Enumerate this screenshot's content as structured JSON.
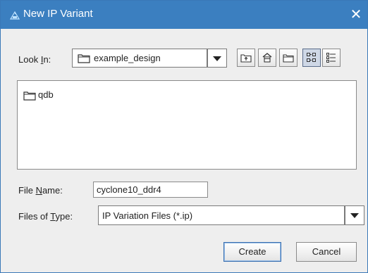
{
  "window": {
    "title": "New IP Variant",
    "close_glyph": "✕",
    "icon": "intel-fpga-icon",
    "titlebar_color": "#3b7fc0"
  },
  "look_in": {
    "label_prefix": "Look ",
    "label_mnemonic": "I",
    "label_suffix": "n:",
    "value": "example_design",
    "icon": "folder-icon"
  },
  "toolbar": {
    "buttons": [
      {
        "name": "up-one-level-button",
        "icon": "folder-up-icon"
      },
      {
        "name": "home-button",
        "icon": "home-icon"
      },
      {
        "name": "create-new-folder-button",
        "icon": "new-folder-icon"
      },
      {
        "name": "list-view-button",
        "icon": "list-view-icon",
        "active": true
      },
      {
        "name": "details-view-button",
        "icon": "details-view-icon"
      }
    ]
  },
  "files": [
    {
      "name": "qdb",
      "icon": "folder-icon"
    }
  ],
  "file_name": {
    "label_prefix": "File ",
    "label_mnemonic": "N",
    "label_suffix": "ame:",
    "value": "cyclone10_ddr4"
  },
  "files_of_type": {
    "label_prefix": "Files of ",
    "label_mnemonic": "T",
    "label_suffix": "ype:",
    "value": "IP Variation Files (*.ip)"
  },
  "buttons": {
    "create": "Create",
    "cancel": "Cancel"
  }
}
